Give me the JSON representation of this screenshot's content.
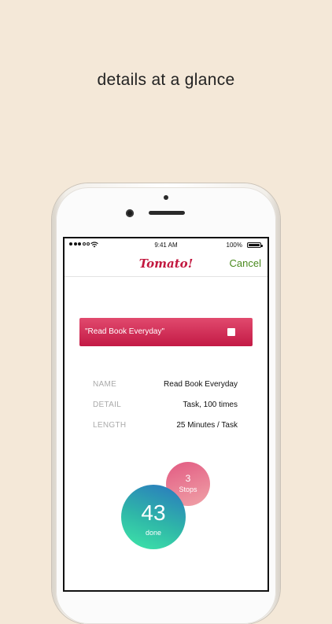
{
  "headline": "details at a glance",
  "status_bar": {
    "time": "9:41 AM",
    "battery_percent": "100%",
    "battery_level": 1.0,
    "signal_bars_filled": 3,
    "signal_bars_total": 5
  },
  "nav": {
    "logo_text": "Tomato!",
    "cancel_label": "Cancel"
  },
  "task_bar": {
    "label": "\"Read Book Everyday\""
  },
  "details": [
    {
      "key": "NAME",
      "value": "Read Book Everyday"
    },
    {
      "key": "DETAIL",
      "value": "Task, 100 times"
    },
    {
      "key": "LENGTH",
      "value": "25 Minutes / Task"
    }
  ],
  "stats": {
    "stops_count": "3",
    "stops_label": "Stops",
    "done_count": "43",
    "done_label": "done"
  },
  "colors": {
    "background": "#f4e8d8",
    "logo": "#c2183f",
    "cancel": "#4a8a1e",
    "task_bar": "#c31a45",
    "detail_key": "#aaaaaa"
  }
}
